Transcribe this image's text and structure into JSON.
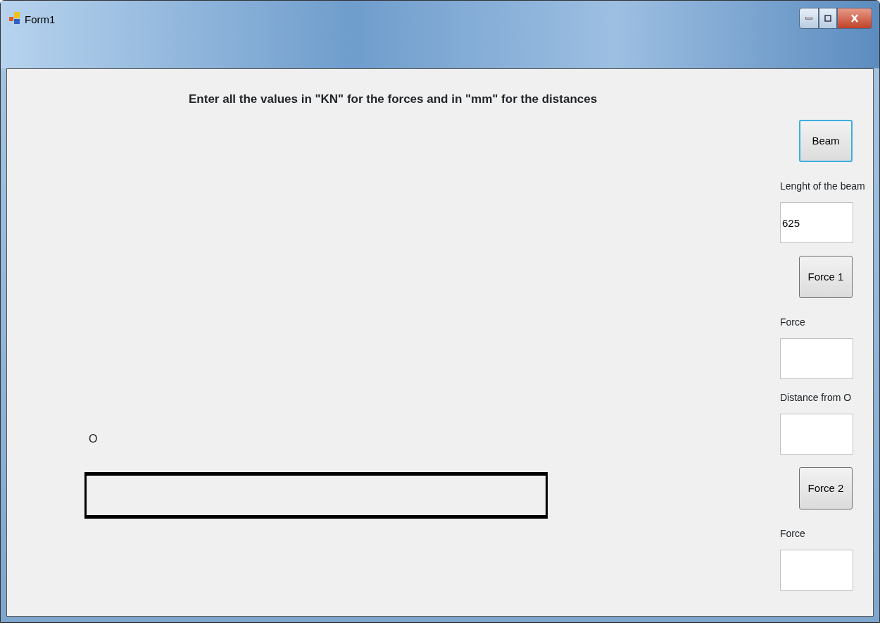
{
  "window": {
    "title": "Form1"
  },
  "instructions": "Enter all the values in \"KN\" for the forces and in \"mm\" for the distances",
  "beam": {
    "origin_label": "O"
  },
  "controls": [
    {
      "kind": "button",
      "label": "Beam",
      "focused": true
    },
    {
      "kind": "label",
      "text": "Lenght of the beam"
    },
    {
      "kind": "field",
      "value": "625"
    },
    {
      "kind": "button",
      "label": "Force 1",
      "focused": false
    },
    {
      "kind": "label",
      "text": "Force"
    },
    {
      "kind": "field"
    },
    {
      "kind": "label",
      "text": "Distance from O"
    },
    {
      "kind": "field"
    },
    {
      "kind": "button",
      "label": "Force 2",
      "focused": false
    },
    {
      "kind": "label",
      "text": "Force"
    },
    {
      "kind": "field"
    }
  ]
}
